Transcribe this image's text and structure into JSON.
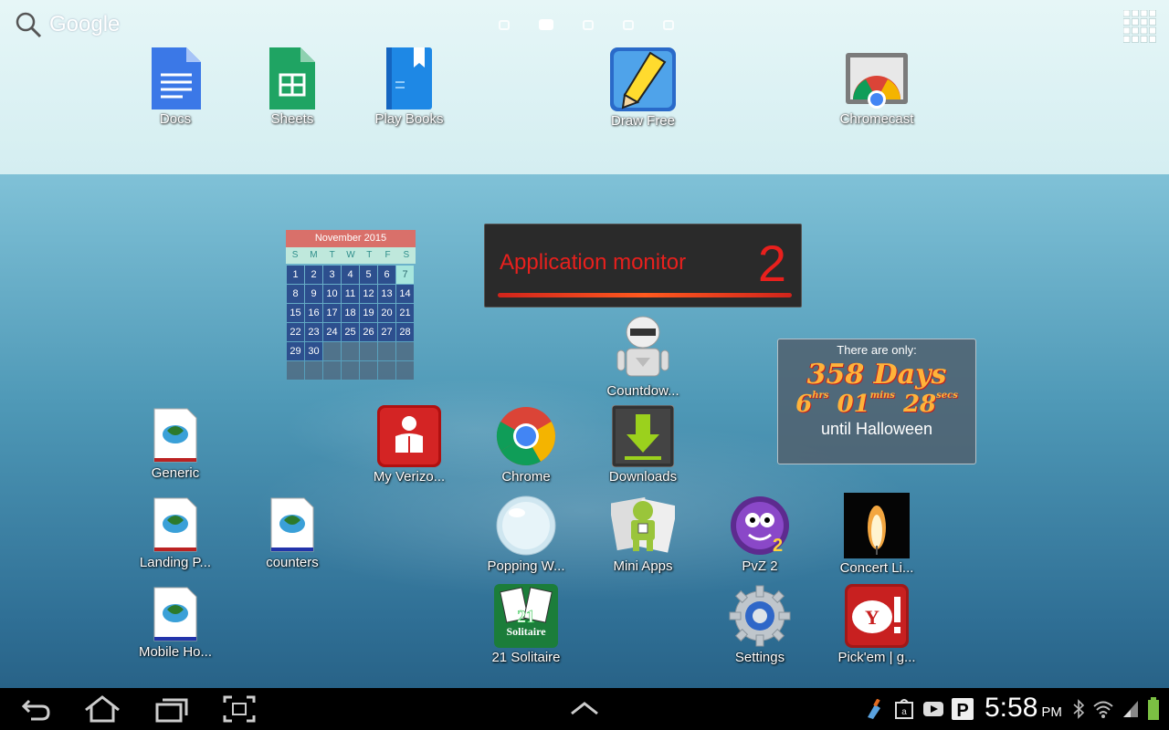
{
  "search": {
    "label": "Google"
  },
  "pages": {
    "count": 5,
    "active_index": 1
  },
  "top_apps": [
    {
      "label": "Docs"
    },
    {
      "label": "Sheets"
    },
    {
      "label": "Play Books"
    },
    {
      "label": "Draw Free"
    },
    {
      "label": "Chromecast"
    }
  ],
  "calendar": {
    "title": "November 2015",
    "dow": [
      "S",
      "M",
      "T",
      "W",
      "T",
      "F",
      "S"
    ],
    "days": [
      "1",
      "2",
      "3",
      "4",
      "5",
      "6",
      "7",
      "8",
      "9",
      "10",
      "11",
      "12",
      "13",
      "14",
      "15",
      "16",
      "17",
      "18",
      "19",
      "20",
      "21",
      "22",
      "23",
      "24",
      "25",
      "26",
      "27",
      "28",
      "29",
      "30"
    ],
    "today": "7"
  },
  "app_monitor": {
    "title": "Application monitor",
    "count": "2"
  },
  "halloween": {
    "top": "There are only:",
    "days": "358 Days",
    "hrs": "6",
    "hrs_unit": "hrs",
    "mins": "01",
    "mins_unit": "mins",
    "secs": "28",
    "secs_unit": "secs",
    "bottom": "until Halloween"
  },
  "apps": {
    "countdown": "Countdow...",
    "generic": "Generic",
    "my_verizon": "My Verizo...",
    "chrome": "Chrome",
    "downloads": "Downloads",
    "landing": "Landing P...",
    "counters": "counters",
    "popping": "Popping W...",
    "mini_apps": "Mini Apps",
    "pvz2": "PvZ 2",
    "concert": "Concert Li...",
    "mobile_ho": "Mobile Ho...",
    "solitaire": "21 Solitaire",
    "settings": "Settings",
    "pickem": "Pick'em | g..."
  },
  "status": {
    "time": "5:58",
    "ampm": "PM"
  },
  "colors": {
    "accent_red": "#e8201d",
    "calendar_blue": "#2d4f8e",
    "calendar_header": "#d9706a"
  }
}
